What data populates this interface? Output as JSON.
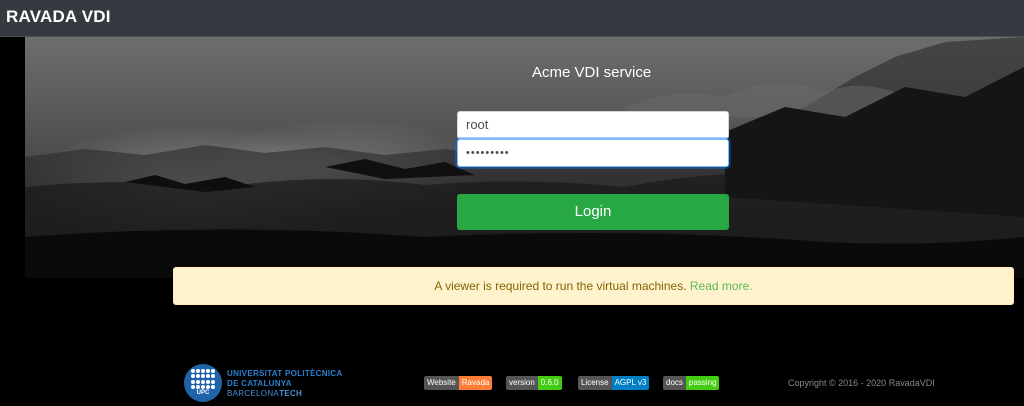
{
  "navbar": {
    "brand": "RAVADA VDI"
  },
  "login": {
    "title": "Acme VDI service",
    "username_value": "root",
    "password_value": "•••••••••",
    "login_label": "Login"
  },
  "alert": {
    "text": "A viewer is required to run the virtual machines.",
    "link_text": "Read more."
  },
  "footer": {
    "logo_text": "UPC",
    "university": [
      "UNIVERSITAT POLITÈCNICA",
      "DE CATALUNYA"
    ],
    "barcelona": "BARCELONA",
    "tech": "TECH",
    "badges": [
      {
        "key": "Website",
        "value": "Ravada",
        "color": "#fe7d37"
      },
      {
        "key": "version",
        "value": "0.6.0",
        "color": "#4c1"
      },
      {
        "key": "License",
        "value": "AGPL v3",
        "color": "#007ec6"
      },
      {
        "key": "docs",
        "value": "passing",
        "color": "#4c1"
      }
    ],
    "copyright": "Copyright © 2016 - 2020 RavadaVDI"
  },
  "colors": {
    "navbar": "#343a40",
    "login_button": "#28a745",
    "alert_bg": "#fff3cd",
    "link": "#5cb85c",
    "upc_blue": "#1f64a8"
  }
}
